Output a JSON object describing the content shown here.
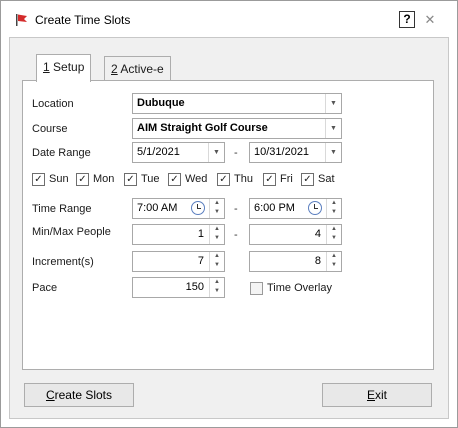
{
  "window": {
    "title": "Create Time Slots",
    "help_label": "?",
    "close_label": "✕"
  },
  "tabs": [
    {
      "hotkey": "1",
      "label": " Setup"
    },
    {
      "hotkey": "2",
      "label": " Active-e"
    }
  ],
  "form": {
    "location": {
      "label": "Location",
      "value": "Dubuque"
    },
    "course": {
      "label": "Course",
      "value": "AIM Straight Golf Course"
    },
    "date_range": {
      "label": "Date Range",
      "start": "5/1/2021",
      "end": "10/31/2021",
      "separator": "-"
    },
    "days": [
      {
        "label": "Sun",
        "checked": "✓"
      },
      {
        "label": "Mon",
        "checked": "✓"
      },
      {
        "label": "Tue",
        "checked": "✓"
      },
      {
        "label": "Wed",
        "checked": "✓"
      },
      {
        "label": "Thu",
        "checked": "✓"
      },
      {
        "label": "Fri",
        "checked": "✓"
      },
      {
        "label": "Sat",
        "checked": "✓"
      }
    ],
    "time_range": {
      "label": "Time Range",
      "start": "7:00 AM",
      "end": "6:00 PM",
      "separator": "-"
    },
    "min_max_people": {
      "label": "Min/Max People",
      "min": "1",
      "max": "4",
      "separator": "-"
    },
    "increments": {
      "label": "Increment(s)",
      "first": "7",
      "second": "8"
    },
    "pace": {
      "label": "Pace",
      "value": "150"
    },
    "time_overlay": {
      "label": "Time Overlay",
      "checked": ""
    }
  },
  "buttons": {
    "create_slots": {
      "hotkey": "C",
      "rest": "reate Slots"
    },
    "exit": {
      "hotkey": "E",
      "rest": "xit"
    }
  },
  "icons": {
    "dropdown": "▼",
    "spin_up": "▲",
    "spin_down": "▼",
    "app": "flag-icon"
  }
}
